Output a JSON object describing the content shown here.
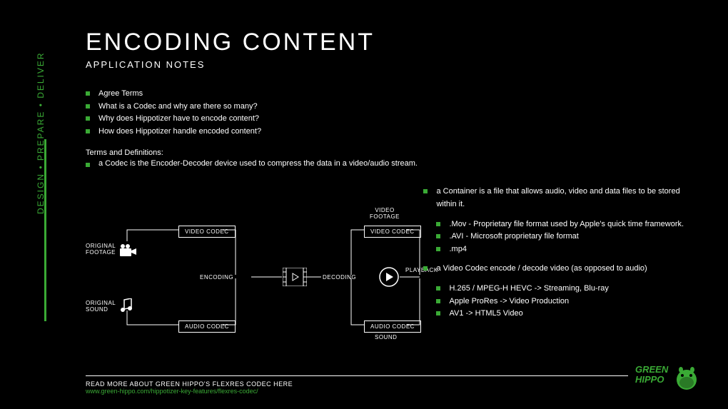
{
  "title": "ENCODING CONTENT",
  "subtitle": "APPLICATION NOTES",
  "side_label": "DESIGN • PREPARE • DELIVER",
  "toc": [
    "Agree Terms",
    "What is a Codec and why are there so many?",
    "Why does Hippotizer have to encode content?",
    "How does Hippotizer handle encoded content?"
  ],
  "defs_heading": "Terms and Definitions:",
  "defs": [
    "a Codec is the Encoder-Decoder device used to compress the data in a video/audio stream."
  ],
  "diagram": {
    "original_footage": "ORIGINAL\nFOOTAGE",
    "original_sound": "ORIGINAL\nSOUND",
    "video_codec": "VIDEO CODEC",
    "audio_codec": "AUDIO CODEC",
    "encoding": "ENCODING",
    "decoding": "DECODING",
    "video_footage": "VIDEO\nFOOTAGE",
    "sound": "SOUND",
    "playback": "PLAYBACK"
  },
  "info": {
    "container": "a Container is a file that allows audio, video and data files to be stored within it.",
    "container_examples": [
      ".Mov - Proprietary file format used by Apple's quick time framework.",
      ".AVI - Microsoft proprietary file format",
      ".mp4"
    ],
    "video_codec": "a Video Codec encode / decode video (as opposed to audio)",
    "video_codec_examples": [
      "H.265 / MPEG-H HEVC -> Streaming, Blu-ray",
      "Apple ProRes -> Video Production",
      "AV1 -> HTML5 Video"
    ]
  },
  "footer": {
    "read_more": "READ MORE ABOUT GREEN HIPPO'S FLEXRES CODEC HERE",
    "link": "www.green-hippo.com/hippotizer-key-features/flexres-codec/"
  },
  "logo_text": "GREEN HIPPO"
}
